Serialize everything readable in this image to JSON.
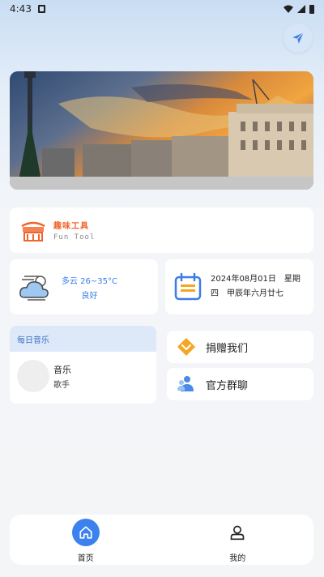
{
  "status_bar": {
    "time": "4:43"
  },
  "fun_tool": {
    "title": "趣味工具",
    "subtitle": "Fun Tool"
  },
  "weather": {
    "temp": "多云 26~35°C",
    "aqi": "良好"
  },
  "date": {
    "line1": "2024年08月01日　星期",
    "line2": "四　甲辰年六月廿七"
  },
  "music": {
    "header": "每日音乐",
    "title": "音乐",
    "artist": "歌手"
  },
  "actions": {
    "donate": "捐赠我们",
    "group": "官方群聊"
  },
  "nav": {
    "home": "首页",
    "me": "我的"
  },
  "colors": {
    "accent": "#3b82ee",
    "fun_orange": "#f0642a",
    "weather_blue": "#3b7ee6"
  },
  "icons": {
    "send": "paper-plane-icon",
    "weather": "cloudy-weather-icon",
    "calendar": "calendar-icon",
    "donate": "diamond-icon",
    "group": "group-users-icon",
    "home": "home-icon",
    "me": "person-icon"
  }
}
